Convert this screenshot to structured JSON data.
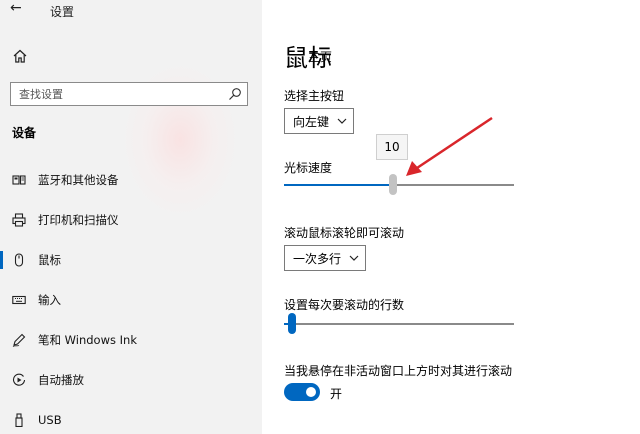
{
  "window": {
    "back_symbol": "←",
    "title": "设置"
  },
  "sidebar": {
    "home_label": "主页",
    "search_placeholder": "查找设置",
    "section_heading": "设备",
    "items": [
      {
        "label": "蓝牙和其他设备",
        "icon": "bluetooth-devices-icon"
      },
      {
        "label": "打印机和扫描仪",
        "icon": "printer-icon"
      },
      {
        "label": "鼠标",
        "icon": "mouse-icon",
        "selected": true
      },
      {
        "label": "输入",
        "icon": "keyboard-icon"
      },
      {
        "label": "笔和 Windows Ink",
        "icon": "pen-icon"
      },
      {
        "label": "自动播放",
        "icon": "autoplay-icon"
      },
      {
        "label": "USB",
        "icon": "usb-icon"
      }
    ]
  },
  "main": {
    "title": "鼠标",
    "primary_button": {
      "label": "选择主按钮",
      "value": "向左键"
    },
    "cursor_speed": {
      "label": "光标速度",
      "value": 10,
      "min": 1,
      "max": 20
    },
    "wheel_scroll": {
      "label": "滚动鼠标滚轮即可滚动",
      "value": "一次多行"
    },
    "lines_per_scroll": {
      "label": "设置每次要滚动的行数",
      "value": 3,
      "min": 1,
      "max": 100
    },
    "inactive_scroll": {
      "label": "当我悬停在非活动窗口上方时对其进行滚动",
      "state": "开"
    }
  },
  "colors": {
    "accent": "#0067c0",
    "arrow": "#d9262b",
    "sidebar_bg": "#f2f2f2"
  }
}
